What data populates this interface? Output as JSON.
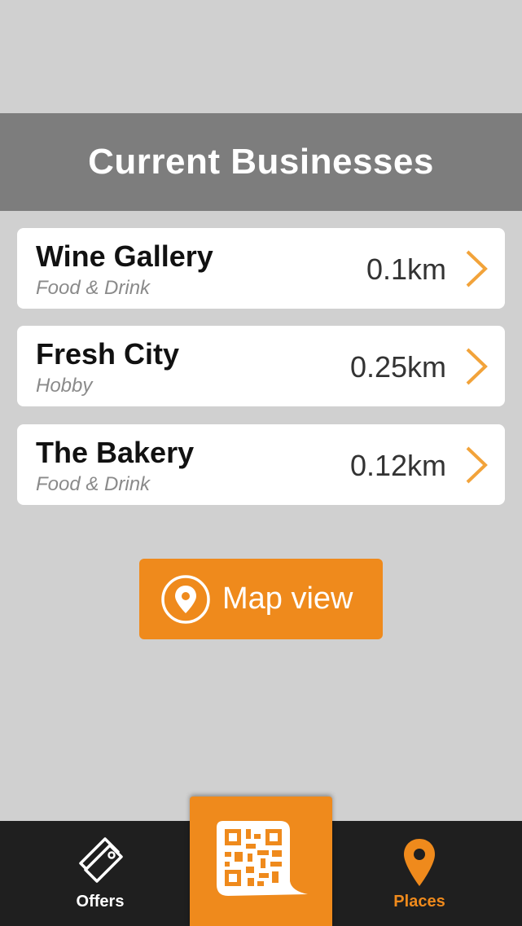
{
  "header": {
    "title": "Current Businesses"
  },
  "businesses": [
    {
      "name": "Wine Gallery",
      "category": "Food & Drink",
      "distance": "0.1km"
    },
    {
      "name": "Fresh City",
      "category": "Hobby",
      "distance": "0.25km"
    },
    {
      "name": "The Bakery",
      "category": "Food & Drink",
      "distance": "0.12km"
    }
  ],
  "map_button": {
    "label": "Map view",
    "icon": "map-pin-circle-icon"
  },
  "tabbar": {
    "offers": {
      "label": "Offers",
      "icon": "tag-icon"
    },
    "scan": {
      "icon": "qr-code-icon"
    },
    "places": {
      "label": "Places",
      "icon": "map-pin-icon"
    }
  },
  "colors": {
    "accent": "#ef8a1c",
    "header_bg": "#7d7d7d",
    "page_bg": "#d0d0d0",
    "tabbar_bg": "#1f1f1f"
  }
}
